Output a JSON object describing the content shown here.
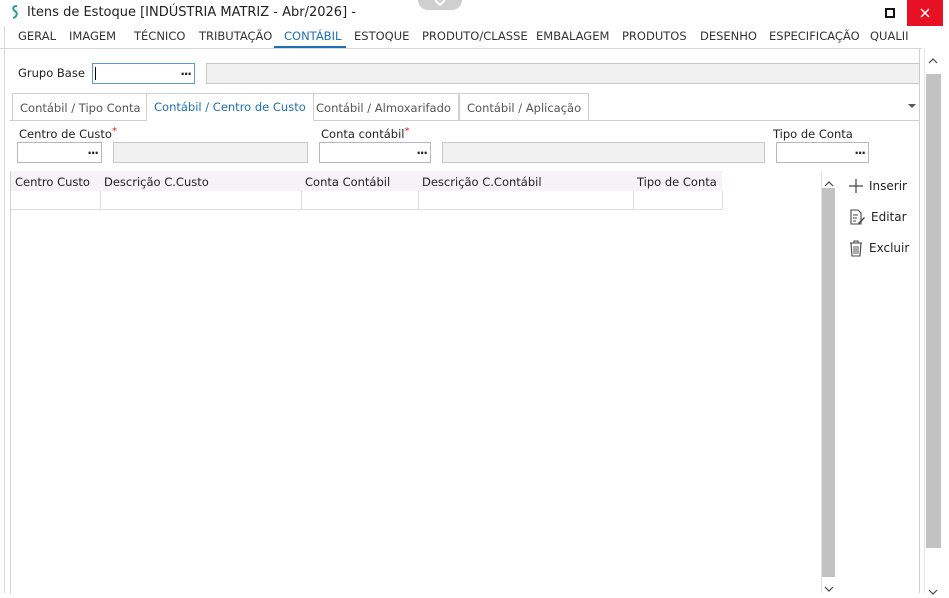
{
  "window": {
    "title": "Itens de Estoque [INDÚSTRIA MATRIZ - Abr/2026]  -"
  },
  "tabs": [
    {
      "label": "GERAL"
    },
    {
      "label": "IMAGEM"
    },
    {
      "label": "TÉCNICO"
    },
    {
      "label": "TRIBUTAÇÃO"
    },
    {
      "label": "CONTÁBIL"
    },
    {
      "label": "ESTOQUE"
    },
    {
      "label": "PRODUTO/CLASSE"
    },
    {
      "label": "EMBALAGEM"
    },
    {
      "label": "PRODUTOS"
    },
    {
      "label": "DESENHO"
    },
    {
      "label": "ESPECIFICAÇÃO"
    },
    {
      "label": "QUALII"
    }
  ],
  "active_tab": "CONTÁBIL",
  "grupo_base": {
    "label": "Grupo Base",
    "value": "",
    "description": ""
  },
  "subtabs": [
    {
      "label": "Contábil / Tipo Conta"
    },
    {
      "label": "Contábil / Centro de Custo"
    },
    {
      "label": "Contábil / Almoxarifado"
    },
    {
      "label": "Contábil / Aplicação"
    }
  ],
  "filters": {
    "centro_custo": {
      "label": "Centro de Custo",
      "required": "*",
      "value": "",
      "description": ""
    },
    "conta_contabil": {
      "label": "Conta contábil",
      "required": "*",
      "value": "",
      "description": ""
    },
    "tipo_conta": {
      "label": "Tipo de Conta",
      "value": ""
    }
  },
  "grid": {
    "columns": [
      "Centro Custo",
      "Descrição C.Custo",
      "Conta Contábil",
      "Descrição C.Contábil",
      "Tipo de Conta"
    ],
    "rows": [
      [
        "",
        "",
        "",
        "",
        ""
      ]
    ]
  },
  "actions": {
    "insert": "Inserir",
    "edit": "Editar",
    "delete": "Excluir"
  },
  "ellipsis": "···",
  "colors": {
    "accent": "#1c6fb5",
    "close": "#e81123",
    "required": "#e02020"
  }
}
